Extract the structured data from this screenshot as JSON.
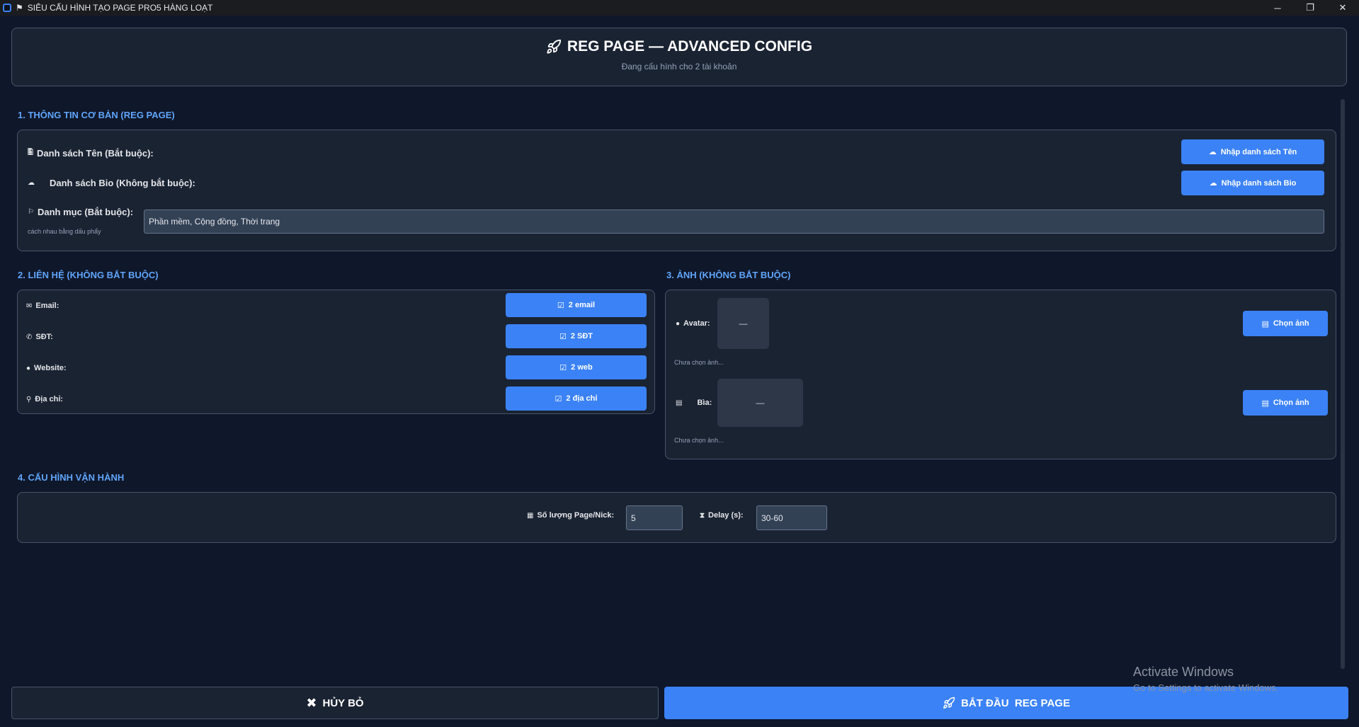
{
  "window": {
    "title": "SIÊU CẤU HÌNH TẠO PAGE PRO5 HÀNG LOẠT",
    "minimize": "─",
    "restore": "❐",
    "close": "✕"
  },
  "header": {
    "icon": "rocket-icon",
    "title": "REG PAGE — ADVANCED CONFIG",
    "subtitle": "Đang cấu hình cho 2 tài khoản"
  },
  "section1": {
    "title": "1. THÔNG TIN CƠ BẢN (REG PAGE)",
    "name_list_label": "Danh sách Tên (Bắt buộc):",
    "bio_list_label": "Danh sách Bio (Không bắt buộc):",
    "category_label": "Danh mục (Bắt buộc):",
    "category_hint": "cách nhau bằng dấu phẩy",
    "category_value": "Phần mềm, Cộng đồng, Thời trang",
    "import_names_button": "Nhập danh sách Tên",
    "import_bio_button": "Nhập danh sách Bio"
  },
  "section2": {
    "title": "2. LIÊN HỆ (KHÔNG BẮT BUỘC)",
    "rows": [
      {
        "label": "Email:",
        "icon": "envelope-icon",
        "button": "2 email"
      },
      {
        "label": "SĐT:",
        "icon": "phone-icon",
        "button": "2 SĐT"
      },
      {
        "label": "Website:",
        "icon": "globe-icon",
        "button": "2 web"
      },
      {
        "label": "Địa chỉ:",
        "icon": "pin-icon",
        "button": "2 địa chỉ"
      }
    ]
  },
  "section3": {
    "title": "3. ẢNH (KHÔNG BẮT BUỘC)",
    "avatar_label": "Avatar:",
    "cover_label": "Bìa:",
    "preview_placeholder": "—",
    "status_text": "Chưa chọn ảnh...",
    "choose_button": "Chọn ảnh"
  },
  "section4": {
    "title": "4. CẤU HÌNH VẬN HÀNH",
    "quantity_label": "Số lượng Page/Nick:",
    "quantity_value": "5",
    "delay_label": "Delay (s):",
    "delay_value": "30-60"
  },
  "footer": {
    "cancel_button": "HỦY BỎ",
    "start_button": "BẮT ĐẦU  REG PAGE"
  },
  "watermark": {
    "line1": "Activate Windows",
    "line2": "Go to Settings to activate Windows."
  },
  "colors": {
    "background": "#0f172a",
    "card": "#1a2332",
    "accent": "#3b82f6",
    "section_title": "#60a5fa"
  }
}
